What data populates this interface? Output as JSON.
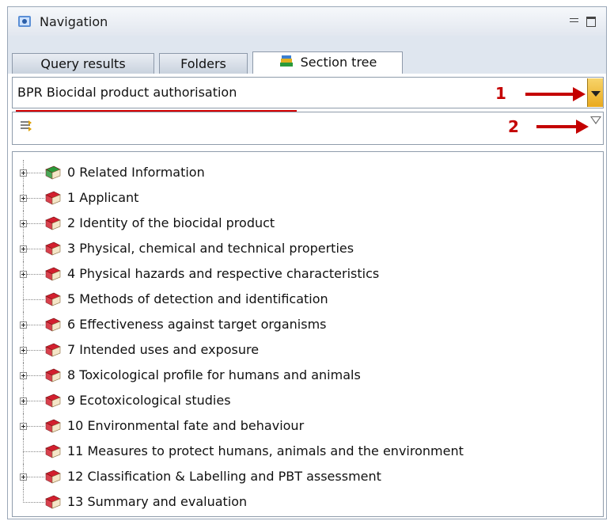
{
  "window": {
    "title": "Navigation",
    "icon": "navigation-icon"
  },
  "tabs": [
    {
      "label": "Query results",
      "active": false
    },
    {
      "label": "Folders",
      "active": false
    },
    {
      "label": "Section tree",
      "active": true,
      "icon": "books-icon"
    }
  ],
  "combo": {
    "value": "BPR Biocidal product authorisation"
  },
  "filter": {
    "placeholder": "",
    "icon": "filter-arrows-icon"
  },
  "annotations": [
    {
      "label": "1"
    },
    {
      "label": "2"
    }
  ],
  "colors": {
    "annotation": "#c40000",
    "book_red": "#d21f2e",
    "book_green": "#2a9a3a"
  },
  "tree": [
    {
      "label": "0 Related Information",
      "expandable": true,
      "book": "green"
    },
    {
      "label": "1 Applicant",
      "expandable": true,
      "book": "red"
    },
    {
      "label": "2 Identity of the biocidal product",
      "expandable": true,
      "book": "red"
    },
    {
      "label": "3 Physical, chemical and technical properties",
      "expandable": true,
      "book": "red"
    },
    {
      "label": "4 Physical hazards and respective characteristics",
      "expandable": true,
      "book": "red"
    },
    {
      "label": "5 Methods of detection and identification",
      "expandable": false,
      "book": "red"
    },
    {
      "label": "6 Effectiveness against target organisms",
      "expandable": true,
      "book": "red"
    },
    {
      "label": "7 Intended uses and exposure",
      "expandable": true,
      "book": "red"
    },
    {
      "label": "8 Toxicological profile for humans and animals",
      "expandable": true,
      "book": "red"
    },
    {
      "label": "9 Ecotoxicological studies",
      "expandable": true,
      "book": "red"
    },
    {
      "label": "10 Environmental fate and behaviour",
      "expandable": true,
      "book": "red"
    },
    {
      "label": "11 Measures to protect humans, animals and the environment",
      "expandable": false,
      "book": "red"
    },
    {
      "label": "12 Classification & Labelling and PBT assessment",
      "expandable": true,
      "book": "red"
    },
    {
      "label": "13 Summary and evaluation",
      "expandable": false,
      "book": "red"
    }
  ]
}
